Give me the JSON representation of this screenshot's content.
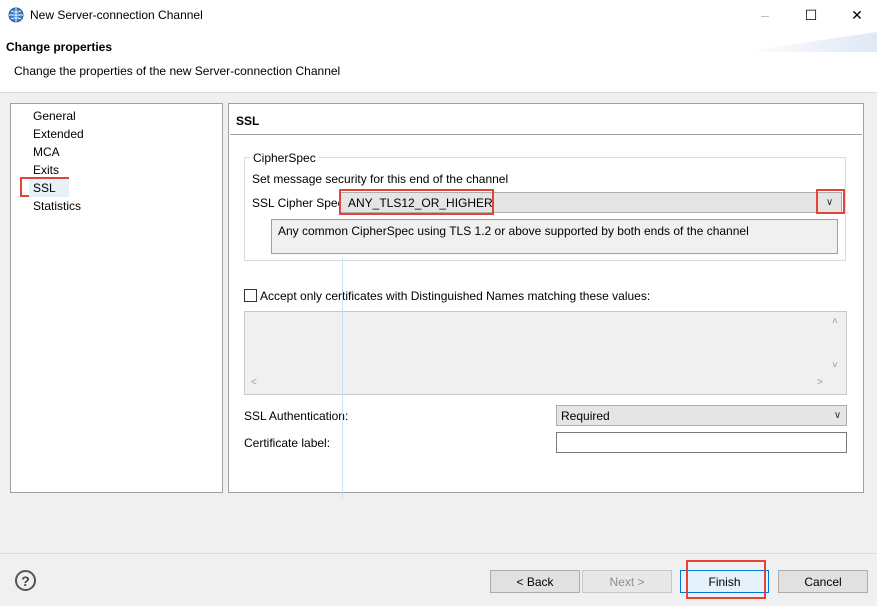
{
  "window": {
    "title": "New Server-connection Channel",
    "minimize_glyph": "–",
    "maximize_glyph": "☐",
    "close_glyph": "✕"
  },
  "header": {
    "title": "Change properties",
    "subtitle": "Change the properties of the new Server-connection Channel"
  },
  "nav": {
    "items": [
      {
        "label": "General"
      },
      {
        "label": "Extended"
      },
      {
        "label": "MCA"
      },
      {
        "label": "Exits"
      },
      {
        "label": "SSL",
        "selected": true
      },
      {
        "label": "Statistics"
      }
    ]
  },
  "panel": {
    "title": "SSL",
    "cipherspec_group": {
      "legend": "CipherSpec",
      "instruction": "Set message security for this end of the channel",
      "cipher_label": "SSL Cipher Spec:",
      "cipher_value": "ANY_TLS12_OR_HIGHER",
      "cipher_description": "Any common CipherSpec using TLS 1.2 or above supported by both ends of the channel"
    },
    "dn_checkbox_label": "Accept only certificates with Distinguished Names matching these values:",
    "dn_checked": false,
    "ssl_auth_label": "SSL Authentication:",
    "ssl_auth_value": "Required",
    "cert_label_label": "Certificate label:",
    "cert_label_value": ""
  },
  "footer": {
    "help_glyph": "?",
    "back_label": "< Back",
    "next_label": "Next >",
    "finish_label": "Finish",
    "cancel_label": "Cancel"
  },
  "colors": {
    "highlight_box": "#e2443a",
    "focus_border": "#0078d7"
  },
  "icons": {
    "dropdown_arrow": "∨",
    "scroll_up": "˄",
    "scroll_down": "˅",
    "scroll_left": "˂",
    "scroll_right": "˃"
  }
}
